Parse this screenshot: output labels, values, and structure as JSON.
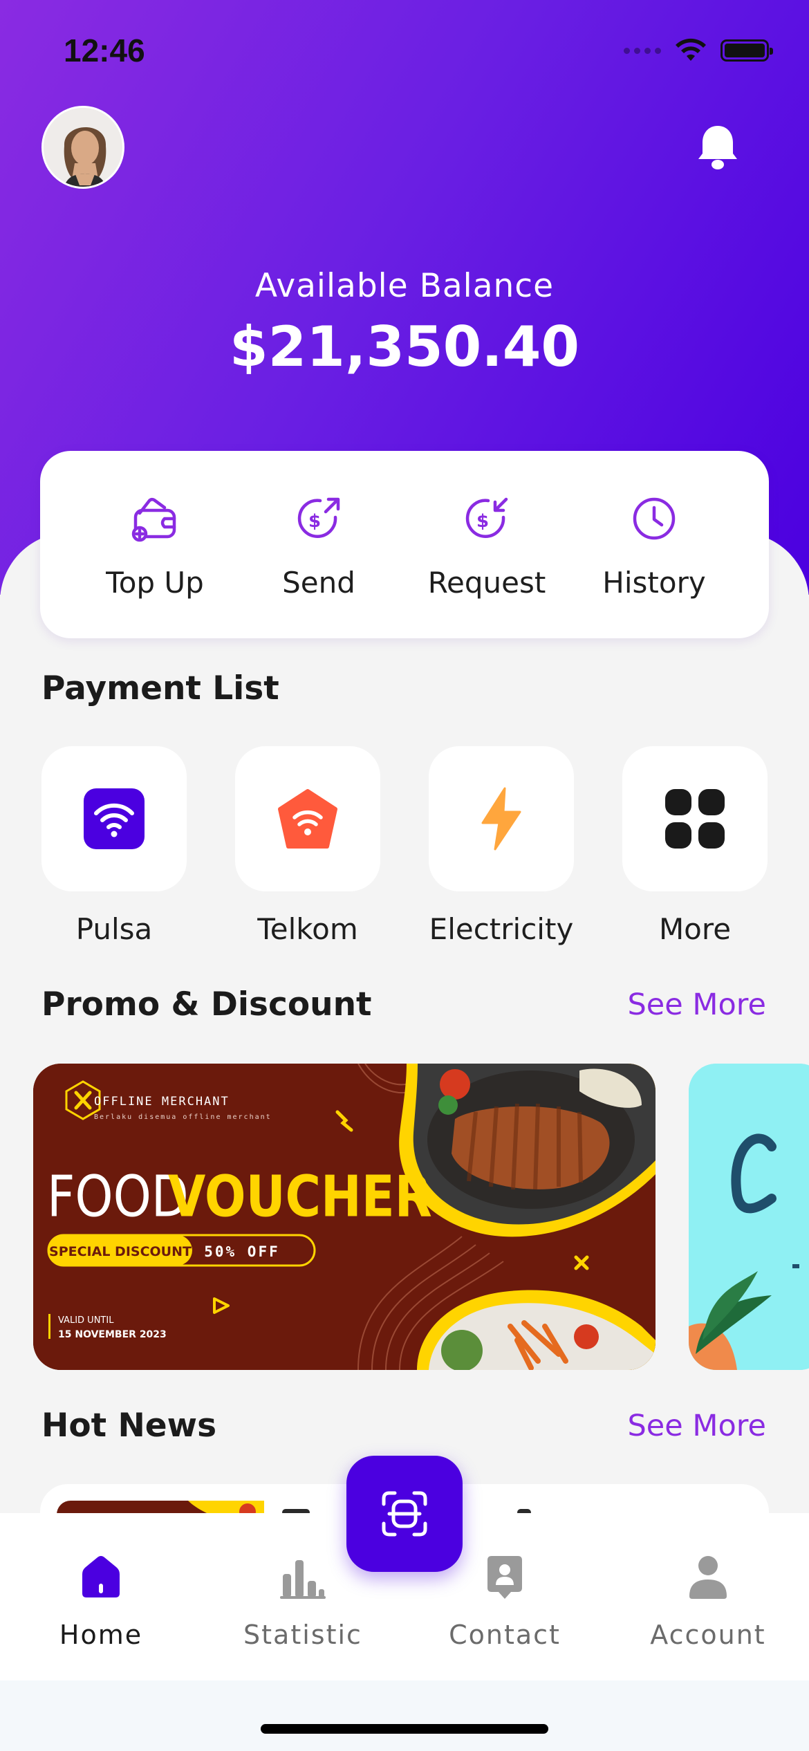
{
  "status_bar": {
    "time": "12:46"
  },
  "header": {
    "avatar_icon": "user-avatar",
    "notification_icon": "bell-icon",
    "balance_label": "Available Balance",
    "balance_value": "$21,350.40"
  },
  "actions": [
    {
      "label": "Top Up",
      "icon": "wallet-plus-icon"
    },
    {
      "label": "Send",
      "icon": "send-money-icon"
    },
    {
      "label": "Request",
      "icon": "request-money-icon"
    },
    {
      "label": "History",
      "icon": "clock-icon"
    }
  ],
  "payment_list": {
    "title": "Payment List",
    "items": [
      {
        "label": "Pulsa",
        "icon": "wifi-icon",
        "color": "#4b00e0"
      },
      {
        "label": "Telkom",
        "icon": "wifi-home-icon",
        "color": "#ff5a3c"
      },
      {
        "label": "Electricity",
        "icon": "lightning-icon",
        "color": "#ffa63d"
      },
      {
        "label": "More",
        "icon": "grid-icon",
        "color": "#1a1a1a"
      }
    ]
  },
  "promo": {
    "title": "Promo & Discount",
    "see_more": "See More",
    "banner": {
      "merchant": "OFFLINE MERCHANT",
      "merchant_sub": "Berlaku disemua offline merchant",
      "headline_1": "FOOD",
      "headline_2": "VOUCHER",
      "badge": "SPECIAL DISCOUNT",
      "discount": "50% OFF",
      "valid_label": "VALID UNTIL",
      "valid_date": "15 NOVEMBER 2023"
    }
  },
  "news": {
    "title": "Hot News",
    "see_more": "See More"
  },
  "bottom_nav": {
    "items": [
      {
        "label": "Home",
        "icon": "home-icon",
        "active": true
      },
      {
        "label": "Statistic",
        "icon": "bar-chart-icon",
        "active": false
      },
      {
        "label": "Contact",
        "icon": "contact-icon",
        "active": false
      },
      {
        "label": "Account",
        "icon": "person-icon",
        "active": false
      }
    ],
    "scan_icon": "scan-icon"
  },
  "colors": {
    "primary": "#4b00e0",
    "accent": "#8a2be2",
    "gradient_start": "#8a2be2",
    "gradient_end": "#4b00e0"
  }
}
